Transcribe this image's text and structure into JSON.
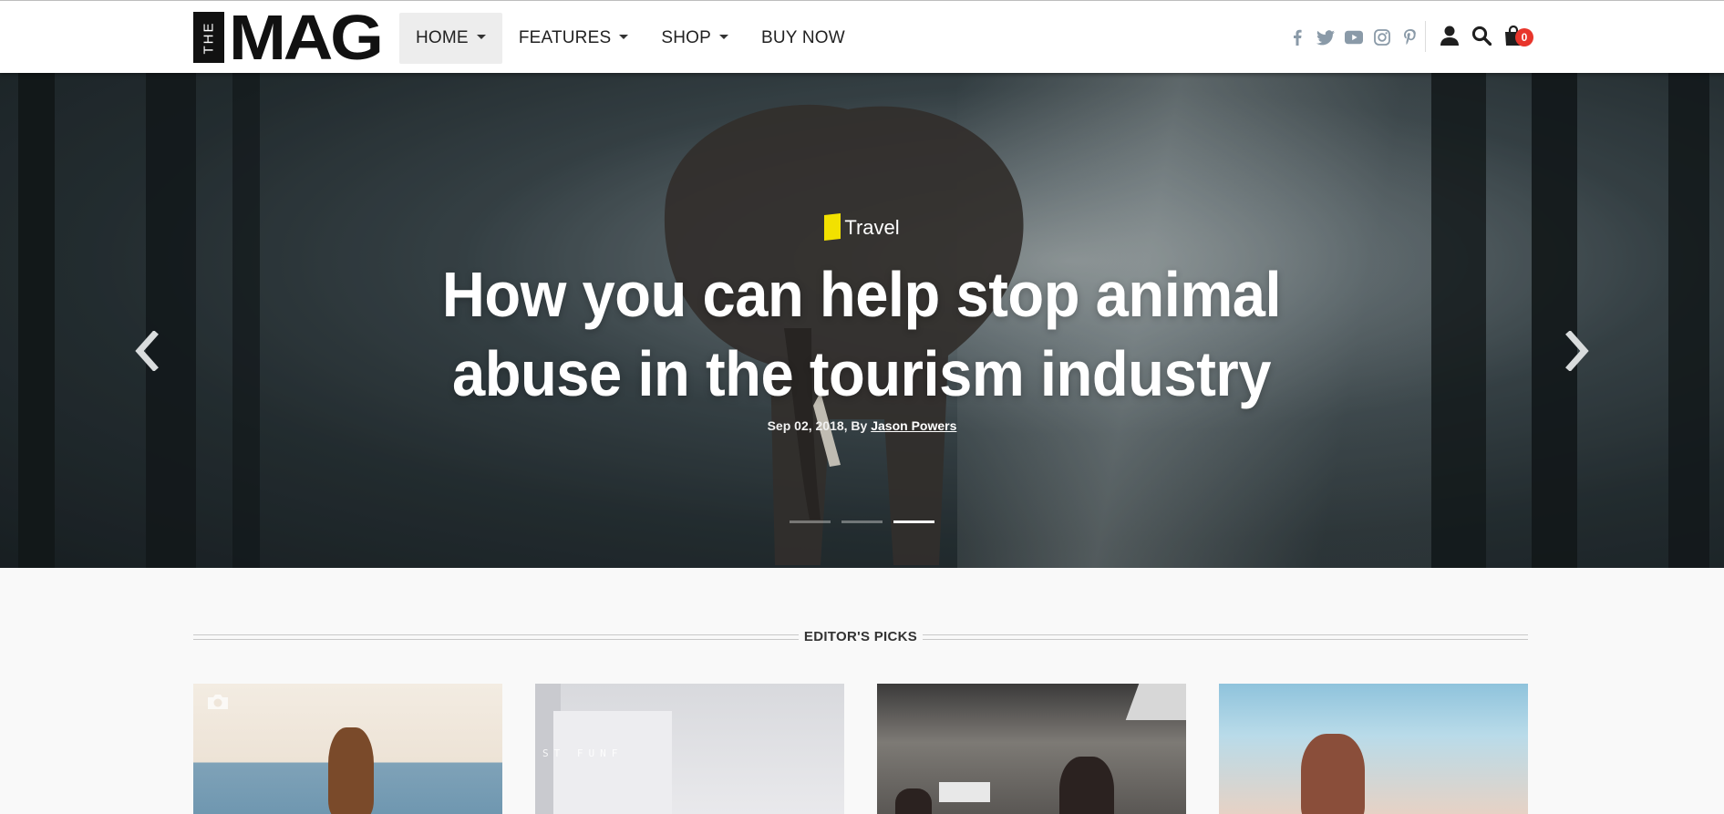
{
  "header": {
    "logo": {
      "small": "THE",
      "big": "MAG"
    },
    "nav": [
      {
        "label": "HOME",
        "dropdown": true,
        "active": true
      },
      {
        "label": "FEATURES",
        "dropdown": true,
        "active": false
      },
      {
        "label": "SHOP",
        "dropdown": true,
        "active": false
      },
      {
        "label": "BUY NOW",
        "dropdown": false,
        "active": false
      }
    ],
    "socials": [
      "facebook-icon",
      "twitter-icon",
      "youtube-icon",
      "instagram-icon",
      "pinterest-icon"
    ],
    "tools": {
      "user": "user-icon",
      "search": "search-icon",
      "cart": "shopping-bag-icon",
      "cart_count": "0"
    }
  },
  "hero": {
    "category": "Travel",
    "title": "How you can help stop animal abuse in the tourism industry",
    "date": "Sep 02, 2018, By ",
    "author": "Jason Powers",
    "slides": 3,
    "active_slide": 3
  },
  "editors_picks": {
    "title": "EDITOR'S PICKS",
    "card2_overlay": "ST FUNF"
  },
  "colors": {
    "accent_yellow": "#f2e100",
    "cart_badge": "#e8352b",
    "social_icon": "#8a9aa8",
    "page_bg": "#f9f9f9"
  }
}
